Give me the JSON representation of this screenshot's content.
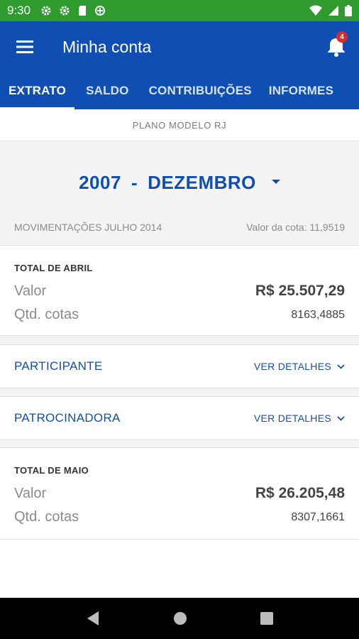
{
  "status_bar": {
    "time": "9:30"
  },
  "app_bar": {
    "title": "Minha conta",
    "notification_count": "4"
  },
  "tabs": [
    {
      "label": "EXTRATO"
    },
    {
      "label": "SALDO"
    },
    {
      "label": "CONTRIBUIÇÕES"
    },
    {
      "label": "INFORMES"
    }
  ],
  "plano": "PLANO MODELO RJ",
  "period": {
    "year": "2007",
    "separator": "-",
    "month": "DEZEMBRO"
  },
  "movimentacoes": {
    "label": "MOVIMENTAÇÕES JULHO 2014",
    "cota": "Valor da cota: 11,9519"
  },
  "total_abril": {
    "title": "TOTAL DE ABRIL",
    "valor_label": "Valor",
    "valor": "R$ 25.507,29",
    "qtd_label": "Qtd. cotas",
    "qtd": "8163,4885"
  },
  "participante": {
    "name": "PARTICIPANTE",
    "link": "VER DETALHES"
  },
  "patrocinadora": {
    "name": "PATROCINADORA",
    "link": "VER DETALHES"
  },
  "total_maio": {
    "title": "TOTAL DE MAIO",
    "valor_label": "Valor",
    "valor": "R$ 26.205,48",
    "qtd_label": "Qtd. cotas",
    "qtd": "8307,1661"
  },
  "colors": {
    "primary": "#0f4fb3",
    "status_bar": "#2f9b2f",
    "badge": "#d32f2f"
  }
}
